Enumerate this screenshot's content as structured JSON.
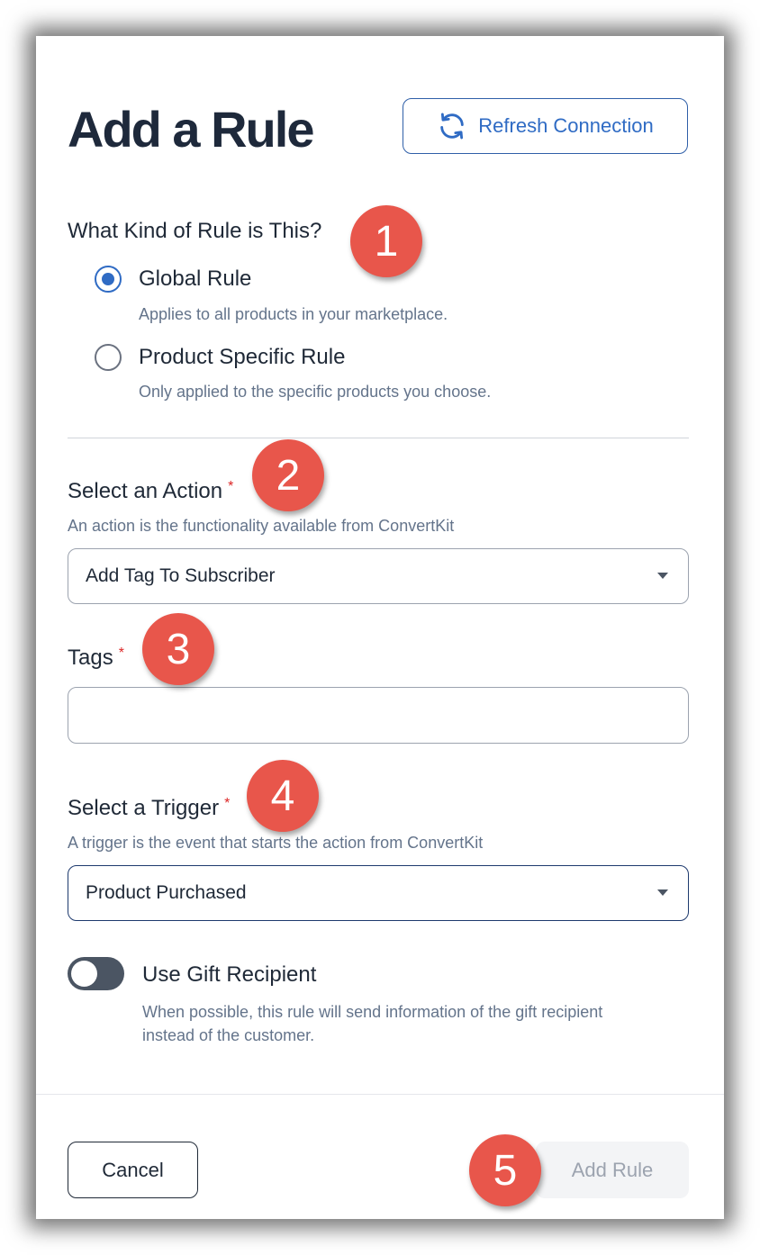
{
  "modal": {
    "title": "Add a Rule",
    "refresh_label": "Refresh Connection"
  },
  "rule_kind": {
    "label": "What Kind of Rule is This?",
    "options": [
      {
        "label": "Global Rule",
        "help": "Applies to all products in your marketplace.",
        "checked": true
      },
      {
        "label": "Product Specific Rule",
        "help": "Only applied to the specific products you choose.",
        "checked": false
      }
    ]
  },
  "action": {
    "label": "Select an Action",
    "required_mark": "*",
    "help": "An action is the functionality available from ConvertKit",
    "value": "Add Tag To Subscriber"
  },
  "tags": {
    "label": "Tags",
    "required_mark": "*",
    "value": ""
  },
  "trigger": {
    "label": "Select a Trigger",
    "required_mark": "*",
    "help": "A trigger is the event that starts the action from ConvertKit",
    "value": "Product Purchased"
  },
  "gift": {
    "label": "Use Gift Recipient",
    "help_line1": "When possible, this rule will send information of the gift recipient",
    "help_line2": "instead of the customer.",
    "enabled": false
  },
  "footer": {
    "cancel_label": "Cancel",
    "add_label": "Add Rule"
  },
  "callouts": [
    "1",
    "2",
    "3",
    "4",
    "5"
  ],
  "colors": {
    "accent": "#2f6bc4",
    "callout": "#e8564b",
    "required": "#dc2626"
  }
}
